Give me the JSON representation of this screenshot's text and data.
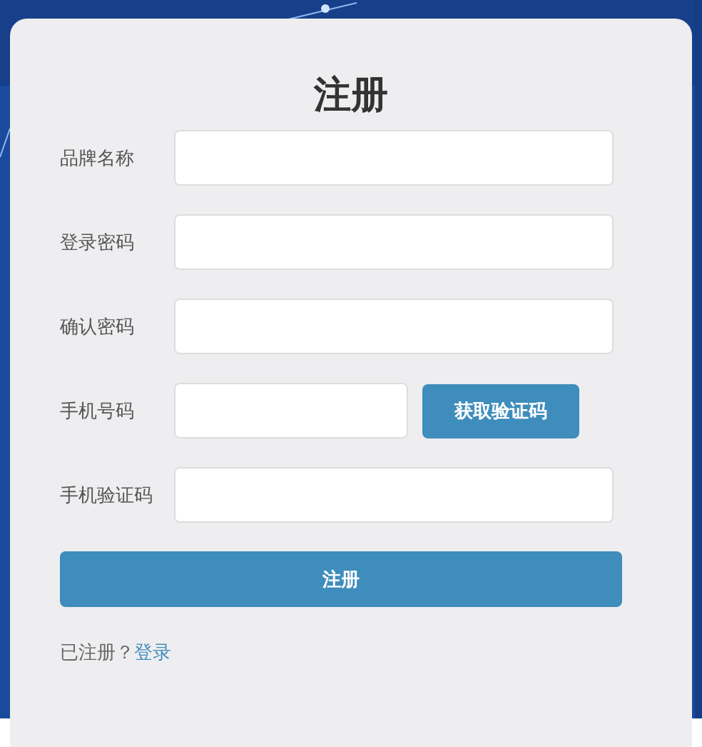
{
  "title": "注册",
  "fields": [
    {
      "label": "品牌名称",
      "kind": "text"
    },
    {
      "label": "登录密码",
      "kind": "text"
    },
    {
      "label": "确认密码",
      "kind": "text"
    },
    {
      "label": "手机号码",
      "kind": "with_button",
      "button": "获取验证码"
    },
    {
      "label": "手机验证码",
      "kind": "text"
    }
  ],
  "submit": "注册",
  "footer": {
    "prompt": "已注册？",
    "link": "登录"
  }
}
